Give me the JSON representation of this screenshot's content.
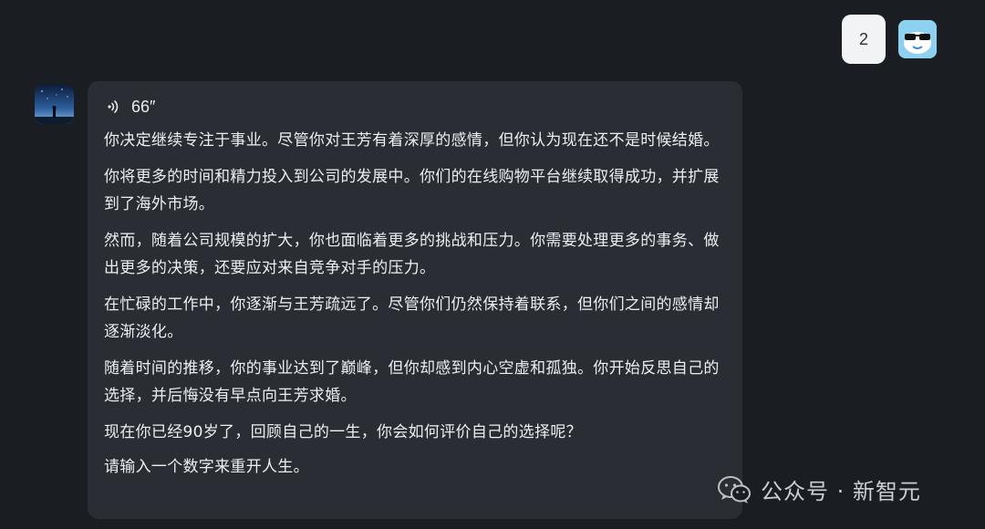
{
  "user_message": {
    "text": "2"
  },
  "bot_message": {
    "voice_duration": "66″",
    "paragraphs": [
      "你决定继续专注于事业。尽管你对王芳有着深厚的感情，但你认为现在还不是时候结婚。",
      "你将更多的时间和精力投入到公司的发展中。你们的在线购物平台继续取得成功，并扩展到了海外市场。",
      "然而，随着公司规模的扩大，你也面临着更多的挑战和压力。你需要处理更多的事务、做出更多的决策，还要应对来自竞争对手的压力。",
      "在忙碌的工作中，你逐渐与王芳疏远了。尽管你们仍然保持着联系，但你们之间的感情却逐渐淡化。",
      "随着时间的推移，你的事业达到了巅峰，但你却感到内心空虚和孤独。你开始反思自己的选择，并后悔没有早点向王芳求婚。",
      "现在你已经90岁了，回顾自己的一生，你会如何评价自己的选择呢？",
      "请输入一个数字来重开人生。"
    ]
  },
  "watermark": {
    "text": "公众号 · 新智元"
  },
  "colors": {
    "background": "#1a1d22",
    "bubble": "#2a2d33",
    "user_bubble": "#f1f3f5",
    "text": "#eceff2"
  },
  "icons": {
    "voice": "sound-wave-icon",
    "user_avatar": "cool-sunglasses-bird-avatar",
    "bot_avatar": "night-sky-figure-avatar",
    "watermark": "wechat-icon"
  }
}
